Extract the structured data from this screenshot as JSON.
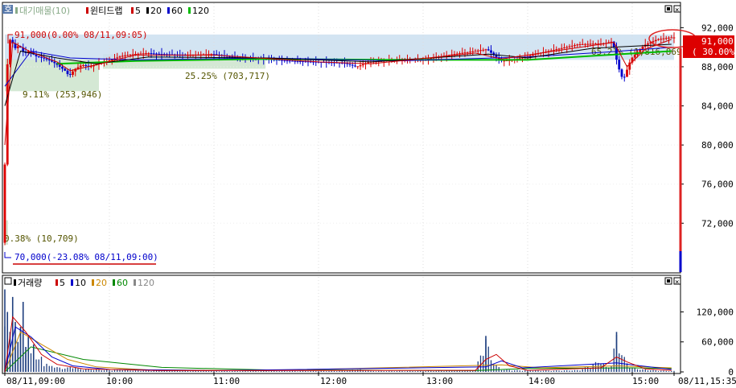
{
  "chart_data": [
    {
      "type": "candlestick",
      "panel": "price",
      "corner_badge": "호",
      "legend": [
        {
          "label": "대기매물(10)",
          "color": "#88aa88"
        },
        {
          "label": "윈티드랩",
          "color": "#cc0000"
        },
        {
          "label": "5",
          "color": "#cc0000"
        },
        {
          "label": "20",
          "color": "#000000"
        },
        {
          "label": "60",
          "color": "#0000cc"
        },
        {
          "label": "120",
          "color": "#00bb00"
        }
      ],
      "ylim": [
        67000,
        94500
      ],
      "yticks": [
        92000,
        88000,
        84000,
        80000,
        76000,
        72000
      ],
      "ytick_labels": [
        "92,000",
        "88,000",
        "84,000",
        "80,000",
        "76,000",
        "72,000"
      ],
      "current_price": {
        "value": 91000,
        "label": "91,000",
        "pct": "( 30.00%)"
      },
      "high_annotation": {
        "value": 91000,
        "text": "91,000(0.00% 08/11,09:05)"
      },
      "low_annotation": {
        "value": 70000,
        "text": "70,000(-23.08% 08/11,09:00)"
      },
      "supply_zones": [
        {
          "pct": "9.11% (253,946)",
          "low": 85500,
          "high": 88800
        },
        {
          "pct": "25.25% (703,717)",
          "low": 87800,
          "high": 89300
        },
        {
          "pct": "65.21% (1,816,869)",
          "low": 88700,
          "high": 91300
        },
        {
          "pct": "0.38% (10,709)",
          "low": 69800,
          "high": 72300
        }
      ],
      "time_ticks": [
        "08/11,09:00",
        "10:00",
        "11:00",
        "12:00",
        "13:00",
        "14:00",
        "15:00",
        "08/11,15:35"
      ],
      "price_path": [
        [
          0,
          70000
        ],
        [
          1,
          86000
        ],
        [
          2,
          90500
        ],
        [
          3,
          91000
        ],
        [
          4,
          89800
        ],
        [
          6,
          90200
        ],
        [
          8,
          89300
        ],
        [
          10,
          89700
        ],
        [
          12,
          89100
        ],
        [
          15,
          88900
        ],
        [
          18,
          88600
        ],
        [
          20,
          88300
        ],
        [
          22,
          87900
        ],
        [
          24,
          87500
        ],
        [
          25,
          87000
        ],
        [
          27,
          87700
        ],
        [
          30,
          88200
        ],
        [
          33,
          88000
        ],
        [
          36,
          88300
        ],
        [
          40,
          88600
        ],
        [
          45,
          89100
        ],
        [
          50,
          89300
        ],
        [
          55,
          89400
        ],
        [
          60,
          89300
        ],
        [
          70,
          89200
        ],
        [
          80,
          89300
        ],
        [
          90,
          88900
        ],
        [
          100,
          88800
        ],
        [
          110,
          88600
        ],
        [
          120,
          88500
        ],
        [
          130,
          88400
        ],
        [
          135,
          88000
        ],
        [
          140,
          88500
        ],
        [
          150,
          88700
        ],
        [
          160,
          88700
        ],
        [
          170,
          89200
        ],
        [
          180,
          89600
        ],
        [
          185,
          89800
        ],
        [
          190,
          88600
        ],
        [
          195,
          88700
        ],
        [
          205,
          89400
        ],
        [
          215,
          90000
        ],
        [
          220,
          90300
        ],
        [
          230,
          90400
        ],
        [
          233,
          90600
        ],
        [
          235,
          88100
        ],
        [
          237,
          86600
        ],
        [
          240,
          88800
        ],
        [
          245,
          90200
        ],
        [
          250,
          90800
        ],
        [
          255,
          91000
        ]
      ],
      "ma5_path": [
        [
          0,
          80000
        ],
        [
          3,
          90500
        ],
        [
          10,
          89500
        ],
        [
          20,
          88500
        ],
        [
          25,
          87600
        ],
        [
          35,
          88200
        ],
        [
          50,
          89200
        ],
        [
          80,
          89200
        ],
        [
          120,
          88500
        ],
        [
          140,
          88300
        ],
        [
          180,
          89400
        ],
        [
          190,
          88800
        ],
        [
          215,
          89800
        ],
        [
          233,
          90500
        ],
        [
          238,
          88000
        ],
        [
          245,
          89800
        ],
        [
          255,
          90800
        ]
      ],
      "ma20_path": [
        [
          0,
          84000
        ],
        [
          6,
          89600
        ],
        [
          20,
          88900
        ],
        [
          35,
          88300
        ],
        [
          55,
          89000
        ],
        [
          100,
          88900
        ],
        [
          140,
          88500
        ],
        [
          185,
          89300
        ],
        [
          200,
          88900
        ],
        [
          225,
          89900
        ],
        [
          255,
          90300
        ]
      ],
      "ma60_path": [
        [
          0,
          86000
        ],
        [
          10,
          89600
        ],
        [
          25,
          88900
        ],
        [
          50,
          88700
        ],
        [
          100,
          88900
        ],
        [
          150,
          88600
        ],
        [
          200,
          89000
        ],
        [
          230,
          89500
        ],
        [
          255,
          90000
        ]
      ],
      "ma120_path": [
        [
          20,
          88300
        ],
        [
          50,
          88600
        ],
        [
          100,
          88800
        ],
        [
          150,
          88700
        ],
        [
          200,
          88700
        ],
        [
          230,
          89200
        ],
        [
          255,
          89600
        ]
      ]
    },
    {
      "type": "bar",
      "panel": "volume",
      "legend": [
        {
          "label": "거래량",
          "color": "#000000"
        },
        {
          "label": "5",
          "color": "#cc0000"
        },
        {
          "label": "10",
          "color": "#0000cc"
        },
        {
          "label": "20",
          "color": "#cc8800"
        },
        {
          "label": "60",
          "color": "#008800"
        },
        {
          "label": "120",
          "color": "#888888"
        }
      ],
      "ylim": [
        0,
        190000
      ],
      "yticks": [
        120000,
        60000,
        0
      ],
      "ytick_labels": [
        "120,000",
        "60,000",
        "0"
      ],
      "spikes": [
        [
          0,
          165000
        ],
        [
          1,
          120000
        ],
        [
          2,
          80000
        ],
        [
          3,
          150000
        ],
        [
          4,
          100000
        ],
        [
          5,
          60000
        ],
        [
          6,
          90000
        ],
        [
          7,
          140000
        ],
        [
          8,
          50000
        ],
        [
          9,
          70000
        ],
        [
          10,
          40000
        ],
        [
          11,
          55000
        ],
        [
          12,
          30000
        ],
        [
          13,
          25000
        ],
        [
          14,
          35000
        ],
        [
          15,
          20000
        ],
        [
          16,
          18000
        ],
        [
          17,
          12000
        ],
        [
          18,
          15000
        ],
        [
          20,
          10000
        ],
        [
          22,
          8000
        ],
        [
          24,
          9000
        ],
        [
          26,
          12000
        ],
        [
          28,
          7000
        ],
        [
          30,
          6000
        ],
        [
          35,
          5000
        ],
        [
          40,
          4000
        ],
        [
          45,
          5000
        ],
        [
          50,
          3000
        ],
        [
          60,
          3000
        ],
        [
          70,
          2500
        ],
        [
          80,
          2000
        ],
        [
          90,
          2000
        ],
        [
          100,
          2000
        ],
        [
          110,
          2000
        ],
        [
          120,
          2000
        ],
        [
          130,
          2500
        ],
        [
          135,
          6000
        ],
        [
          140,
          2000
        ],
        [
          150,
          2000
        ],
        [
          160,
          2000
        ],
        [
          170,
          3000
        ],
        [
          180,
          4000
        ],
        [
          184,
          72000
        ],
        [
          186,
          30000
        ],
        [
          188,
          15000
        ],
        [
          190,
          5000
        ],
        [
          200,
          3000
        ],
        [
          210,
          3000
        ],
        [
          220,
          4000
        ],
        [
          228,
          25000
        ],
        [
          230,
          10000
        ],
        [
          232,
          15000
        ],
        [
          234,
          80000
        ],
        [
          236,
          40000
        ],
        [
          238,
          20000
        ],
        [
          240,
          8000
        ],
        [
          245,
          5000
        ],
        [
          250,
          3000
        ],
        [
          255,
          2000
        ]
      ],
      "ma5_path": [
        [
          0,
          0
        ],
        [
          3,
          110000
        ],
        [
          8,
          80000
        ],
        [
          14,
          35000
        ],
        [
          20,
          15000
        ],
        [
          30,
          6000
        ],
        [
          60,
          2500
        ],
        [
          180,
          3000
        ],
        [
          184,
          25000
        ],
        [
          188,
          35000
        ],
        [
          193,
          12000
        ],
        [
          200,
          3000
        ],
        [
          228,
          8000
        ],
        [
          234,
          30000
        ],
        [
          238,
          20000
        ],
        [
          245,
          6000
        ],
        [
          255,
          3000
        ]
      ],
      "ma10_path": [
        [
          0,
          0
        ],
        [
          4,
          90000
        ],
        [
          10,
          70000
        ],
        [
          18,
          30000
        ],
        [
          26,
          12000
        ],
        [
          40,
          5000
        ],
        [
          80,
          2500
        ],
        [
          184,
          10000
        ],
        [
          190,
          22000
        ],
        [
          198,
          8000
        ],
        [
          234,
          18000
        ],
        [
          240,
          14000
        ],
        [
          255,
          5000
        ]
      ],
      "ma20_path": [
        [
          0,
          0
        ],
        [
          6,
          80000
        ],
        [
          14,
          55000
        ],
        [
          24,
          25000
        ],
        [
          35,
          10000
        ],
        [
          55,
          4000
        ],
        [
          100,
          2500
        ],
        [
          190,
          14000
        ],
        [
          205,
          8000
        ],
        [
          234,
          12000
        ],
        [
          255,
          8000
        ]
      ],
      "ma60_path": [
        [
          0,
          0
        ],
        [
          10,
          50000
        ],
        [
          30,
          25000
        ],
        [
          60,
          9000
        ],
        [
          100,
          4000
        ],
        [
          180,
          2500
        ],
        [
          200,
          7000
        ],
        [
          240,
          8000
        ],
        [
          255,
          7000
        ]
      ]
    }
  ]
}
